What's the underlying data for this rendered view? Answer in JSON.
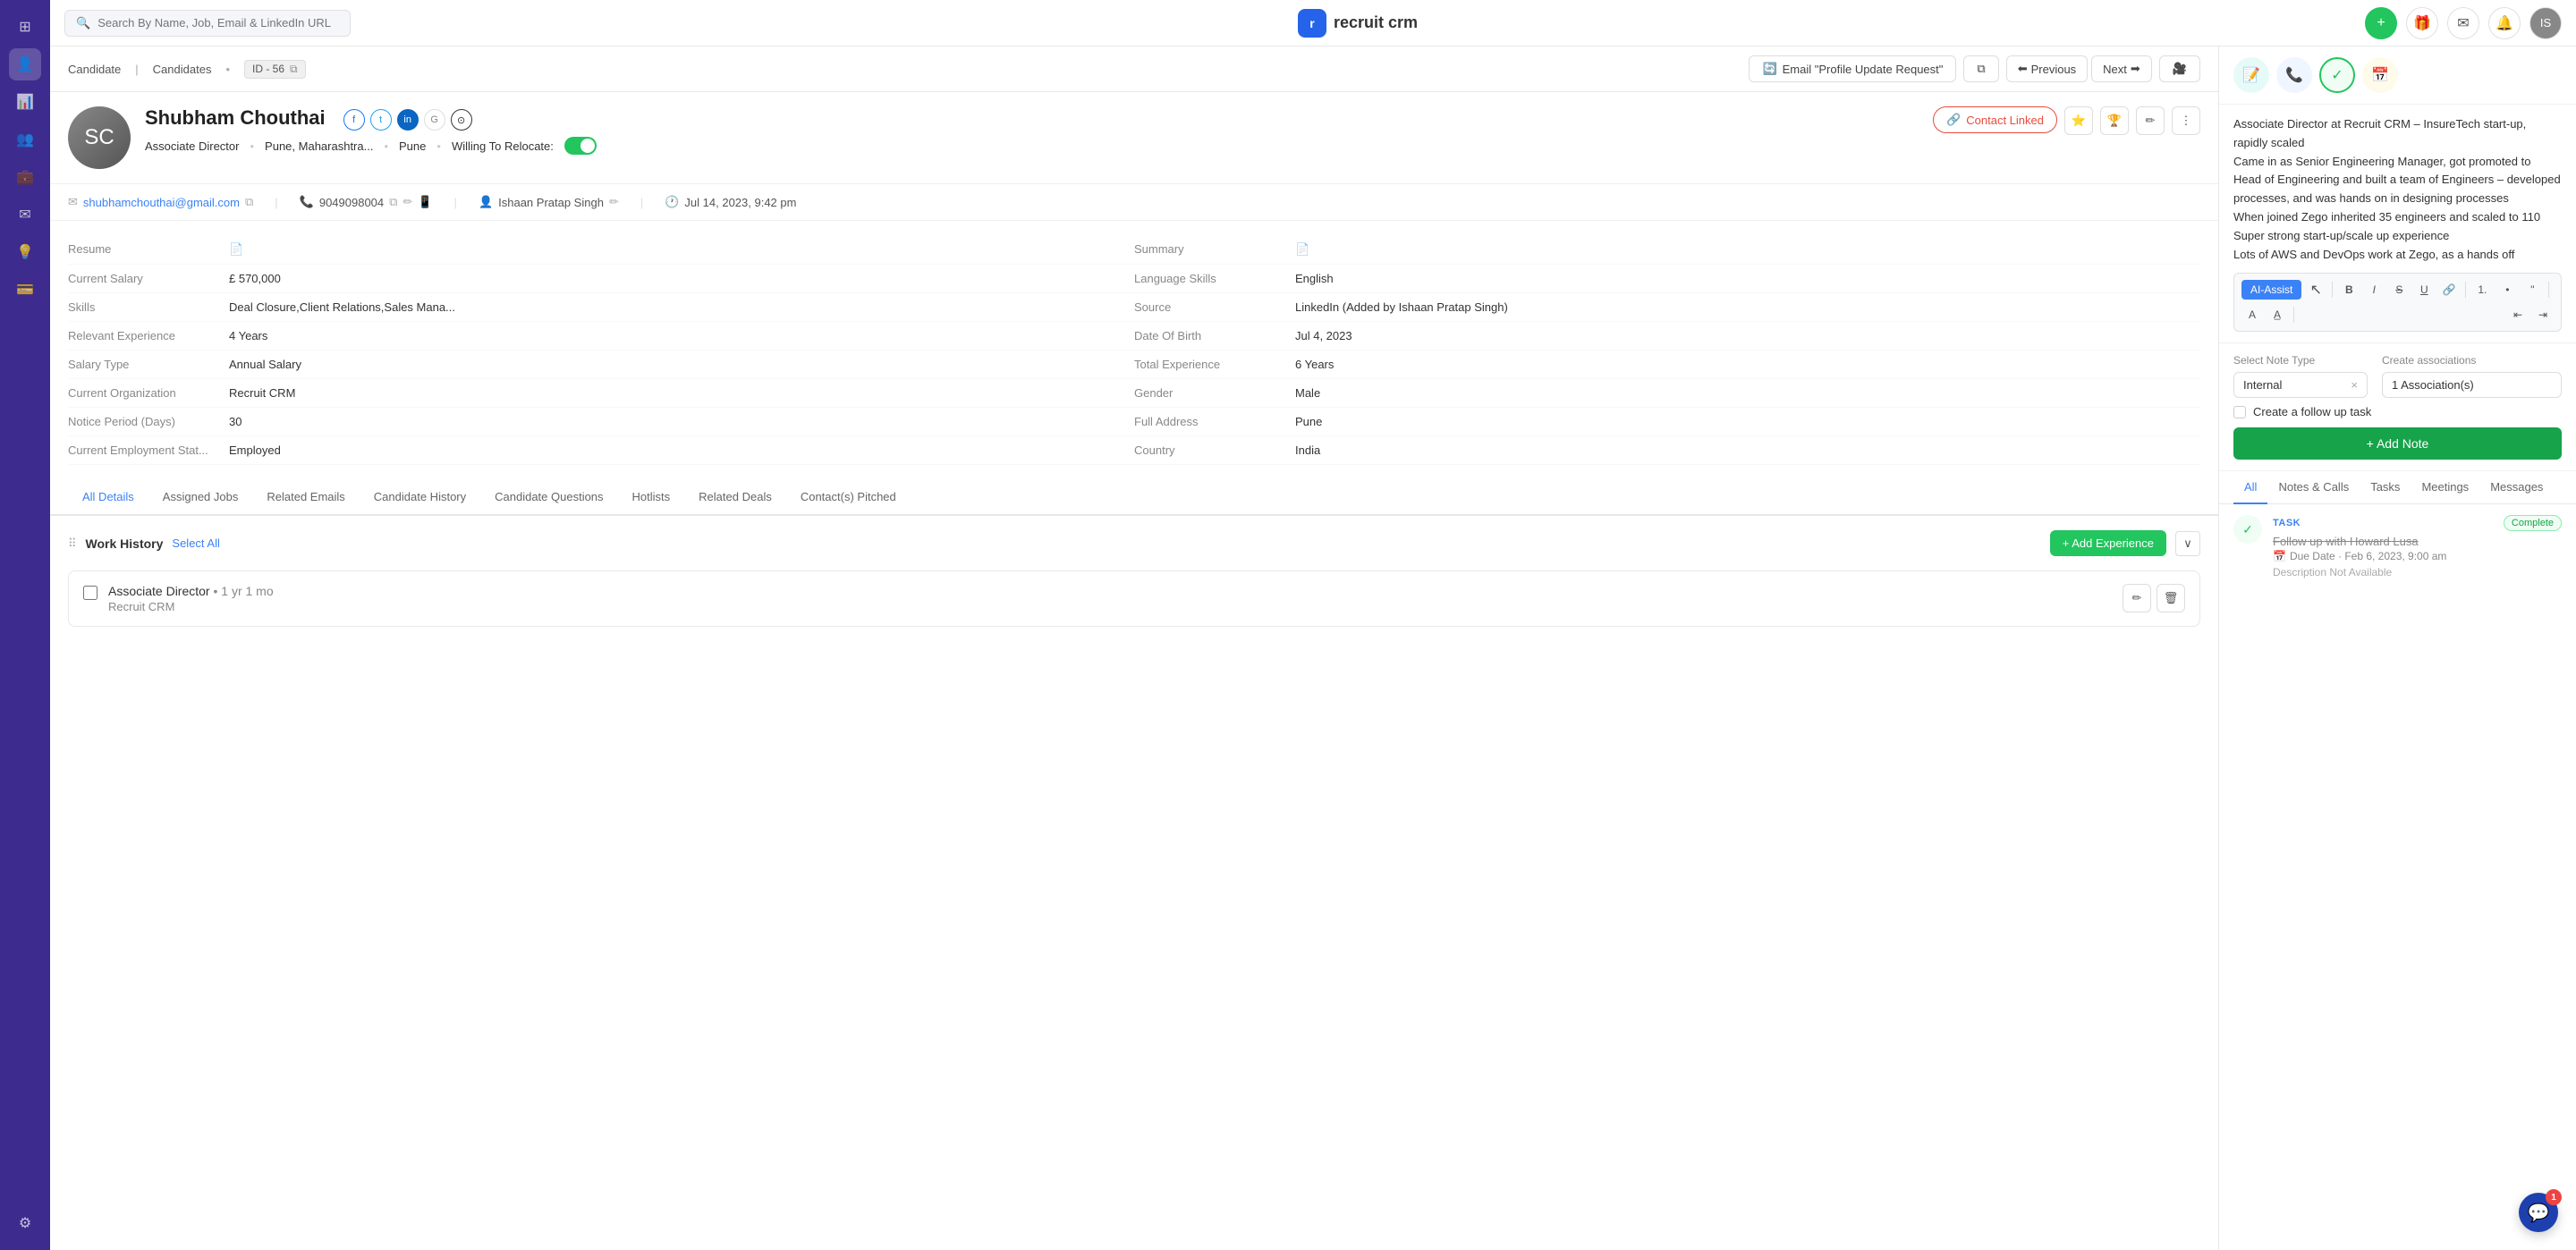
{
  "topnav": {
    "search_placeholder": "Search By Name, Job, Email & LinkedIn URL",
    "logo_text": "recruit crm",
    "logo_initial": "r"
  },
  "breadcrumb": {
    "item1": "Candidate",
    "item2": "Candidates",
    "id_label": "ID - 56",
    "email_btn": "Email \"Profile Update Request\"",
    "prev_btn": "Previous",
    "next_btn": "Next"
  },
  "candidate": {
    "name": "Shubham Chouthai",
    "title": "Associate Director",
    "location": "Pune, Maharashtra...",
    "city": "Pune",
    "relocate_label": "Willing To Relocate:",
    "contact_linked_label": "Contact Linked",
    "email": "shubhamchouthai@gmail.com",
    "phone": "9049098004",
    "owner": "Ishaan Pratap Singh",
    "updated": "Jul 14, 2023, 9:42 pm",
    "resume_label": "Resume",
    "summary_label": "Summary",
    "current_salary_label": "Current Salary",
    "current_salary": "£ 570,000",
    "language_skills_label": "Language Skills",
    "language_skills": "English",
    "skills_label": "Skills",
    "skills": "Deal Closure,Client Relations,Sales Mana...",
    "source_label": "Source",
    "source": "LinkedIn (Added by Ishaan Pratap Singh)",
    "relevant_exp_label": "Relevant Experience",
    "relevant_exp": "4 Years",
    "dob_label": "Date Of Birth",
    "dob": "Jul 4, 2023",
    "salary_type_label": "Salary Type",
    "salary_type": "Annual Salary",
    "total_exp_label": "Total Experience",
    "total_exp": "6 Years",
    "current_org_label": "Current Organization",
    "current_org": "Recruit CRM",
    "gender_label": "Gender",
    "gender": "Male",
    "notice_days_label": "Notice Period (Days)",
    "notice_days": "30",
    "full_address_label": "Full Address",
    "full_address": "Pune",
    "emp_status_label": "Current Employment Stat...",
    "emp_status": "Employed",
    "country_label": "Country",
    "country": "India"
  },
  "tabs": [
    {
      "label": "All Details",
      "active": true
    },
    {
      "label": "Assigned Jobs",
      "active": false
    },
    {
      "label": "Related Emails",
      "active": false
    },
    {
      "label": "Candidate History",
      "active": false
    },
    {
      "label": "Candidate Questions",
      "active": false
    },
    {
      "label": "Hotlists",
      "active": false
    },
    {
      "label": "Related Deals",
      "active": false
    },
    {
      "label": "Contact(s) Pitched",
      "active": false
    }
  ],
  "work_history": {
    "section_title": "Work History",
    "select_all": "Select All",
    "add_exp_btn": "+ Add Experience",
    "job": {
      "title": "Associate Director",
      "duration": "1 yr 1 mo",
      "company": "Recruit CRM"
    }
  },
  "right_panel": {
    "note_content": "Associate Director at Recruit CRM – InsureTech start-up, rapidly scaled\nCame in as Senior Engineering Manager, got promoted to Head of Engineering and built a team of Engineers – developed processes, and was hands on in designing processes\nWhen joined Zego inherited 35 engineers and scaled to 110\nSuper strong start-up/scale up experience\nLots of AWS and DevOps work at Zego, as a hands off",
    "ai_assist_btn": "AI-Assist",
    "note_type_label": "Select Note Type",
    "note_type_value": "Internal",
    "associations_label": "Create associations",
    "associations_value": "1 Association(s)",
    "follow_up_label": "Create a follow up task",
    "add_note_btn": "+ Add Note"
  },
  "activity_tabs": [
    {
      "label": "All",
      "active": true
    },
    {
      "label": "Notes & Calls",
      "active": false
    },
    {
      "label": "Tasks",
      "active": false
    },
    {
      "label": "Meetings",
      "active": false
    },
    {
      "label": "Messages",
      "active": false
    }
  ],
  "task": {
    "type": "TASK",
    "title": "Follow up with Howard Lusa",
    "due": "Due Date · Feb 6, 2023, 9:00 am",
    "desc": "Description Not Available",
    "status": "Complete"
  },
  "sidebar_icons": [
    "grid",
    "person",
    "chart",
    "people",
    "briefcase",
    "mail",
    "lightbulb",
    "card",
    "settings"
  ],
  "chat_badge": "1"
}
